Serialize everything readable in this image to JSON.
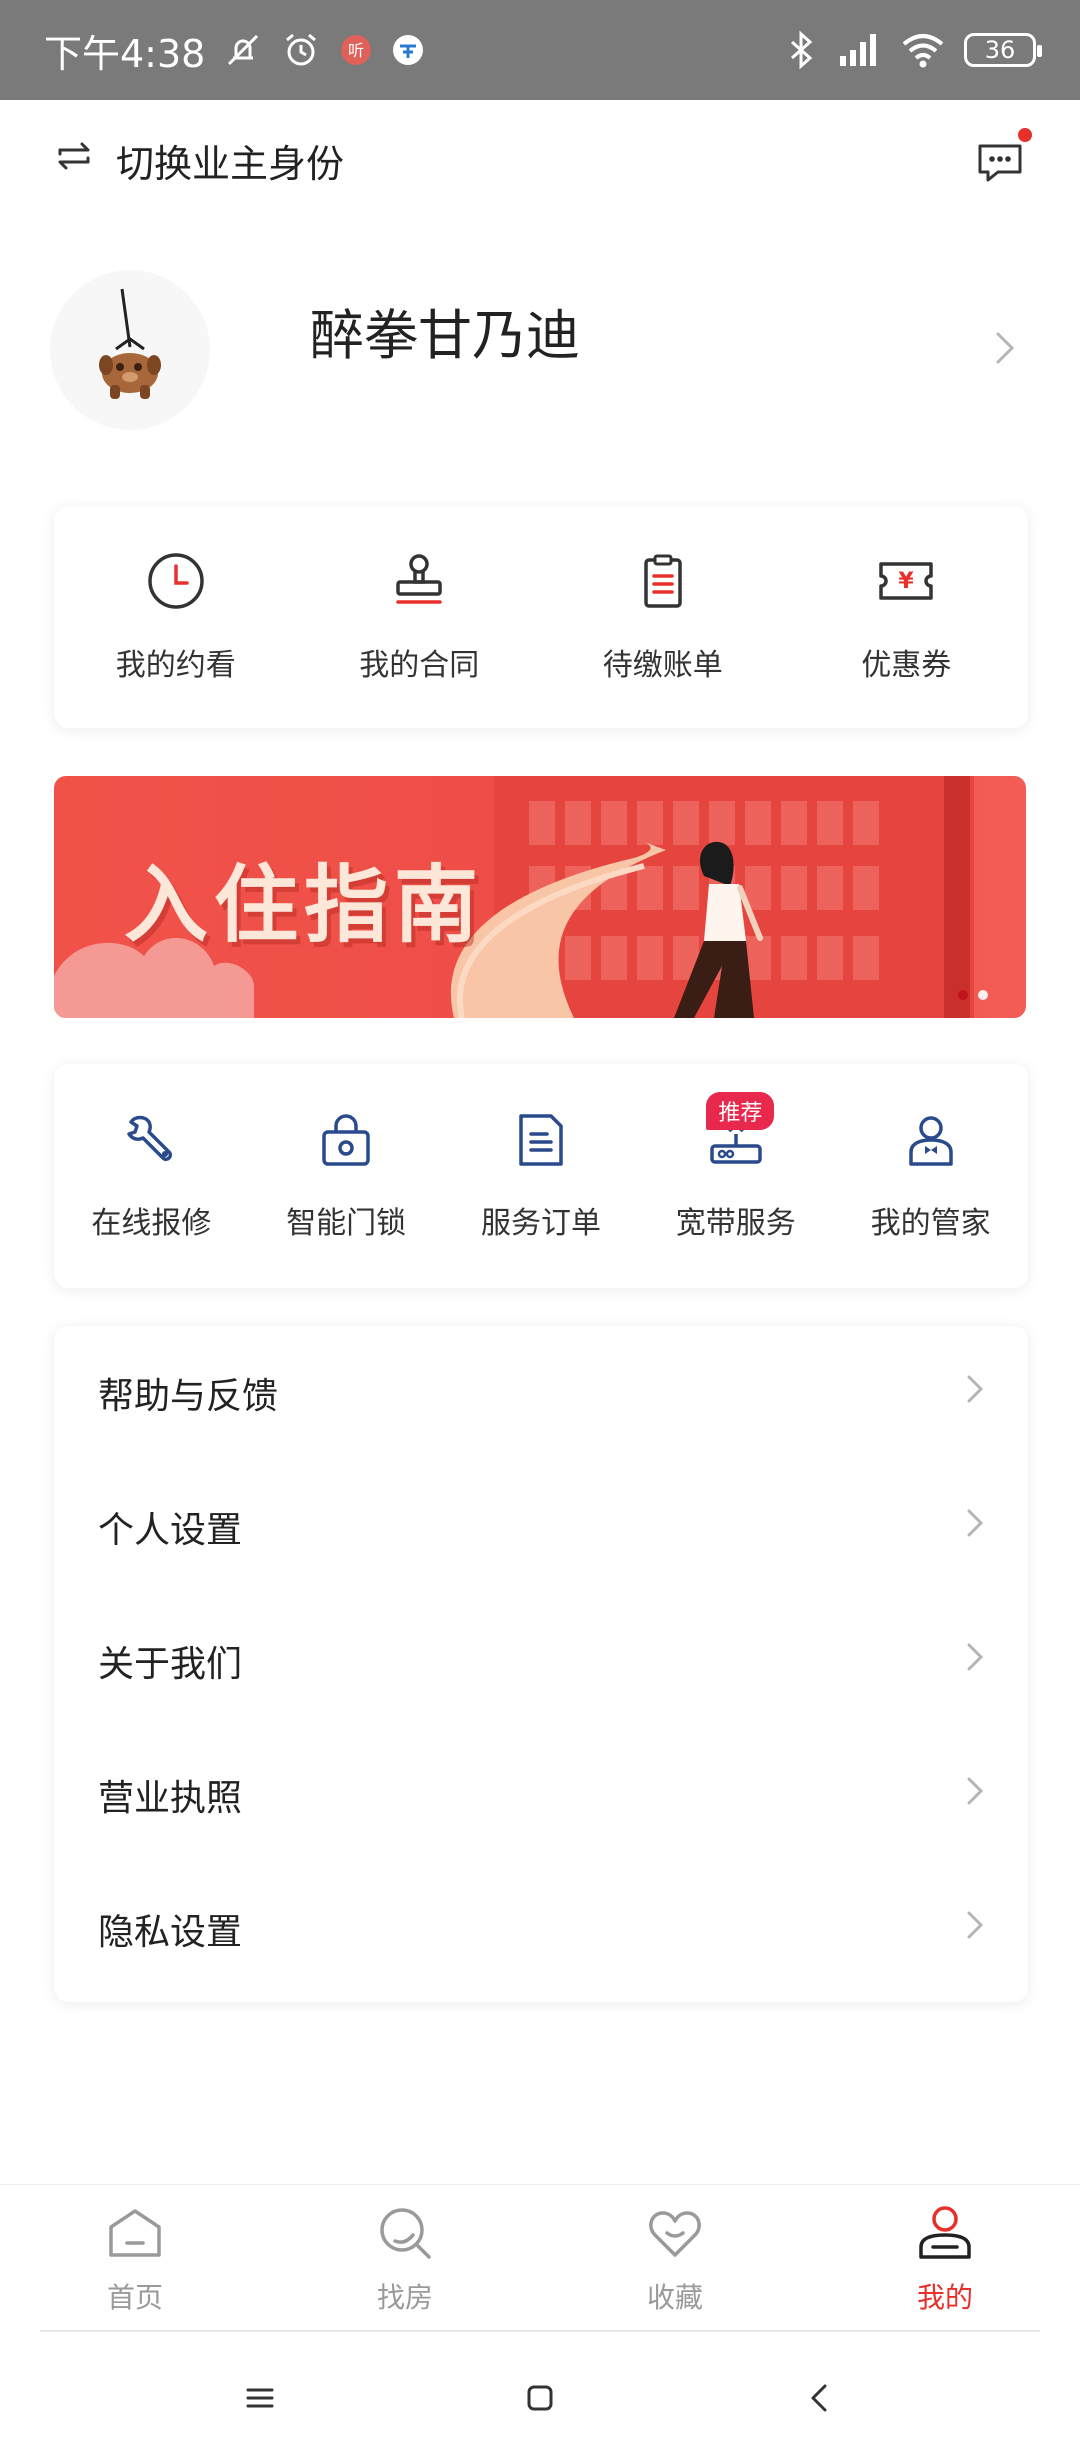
{
  "status_bar": {
    "time": "下午4:38",
    "battery": "36"
  },
  "header": {
    "switch_label": "切换业主身份"
  },
  "profile": {
    "name": "醉拳甘乃迪"
  },
  "quick_actions": [
    {
      "label": "我的约看",
      "icon": "clock-icon"
    },
    {
      "label": "我的合同",
      "icon": "stamp-icon"
    },
    {
      "label": "待缴账单",
      "icon": "clipboard-icon"
    },
    {
      "label": "优惠券",
      "icon": "coupon-icon"
    }
  ],
  "banner": {
    "title": "入住指南",
    "slide_count": 2,
    "active_slide": 1
  },
  "services": [
    {
      "label": "在线报修",
      "icon": "wrench-icon"
    },
    {
      "label": "智能门锁",
      "icon": "lock-icon"
    },
    {
      "label": "服务订单",
      "icon": "document-icon"
    },
    {
      "label": "宽带服务",
      "icon": "router-icon",
      "badge": "推荐"
    },
    {
      "label": "我的管家",
      "icon": "butler-icon"
    }
  ],
  "menu": [
    {
      "label": "帮助与反馈"
    },
    {
      "label": "个人设置"
    },
    {
      "label": "关于我们"
    },
    {
      "label": "营业执照"
    },
    {
      "label": "隐私设置"
    }
  ],
  "bottom_nav": [
    {
      "label": "首页",
      "icon": "home-icon",
      "active": false
    },
    {
      "label": "找房",
      "icon": "search-icon",
      "active": false
    },
    {
      "label": "收藏",
      "icon": "heart-icon",
      "active": false
    },
    {
      "label": "我的",
      "icon": "user-icon",
      "active": true
    }
  ],
  "colors": {
    "accent": "#e8302a",
    "icon_blue": "#2a4a8c",
    "badge": "#e8284d"
  }
}
